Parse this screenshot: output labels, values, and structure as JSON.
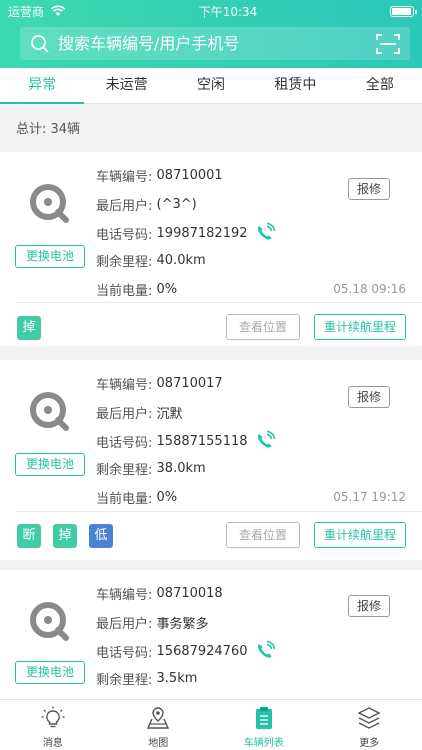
{
  "status_bar": {
    "carrier": "运营商",
    "time": "下午10:34"
  },
  "search": {
    "placeholder": "搜索车辆编号/用户手机号"
  },
  "tabs": [
    {
      "label": "异常",
      "active": true
    },
    {
      "label": "未运营",
      "active": false
    },
    {
      "label": "空闲",
      "active": false
    },
    {
      "label": "租赁中",
      "active": false
    },
    {
      "label": "全部",
      "active": false
    }
  ],
  "summary": {
    "total": "总计: 34辆"
  },
  "labels": {
    "vehicle_no": "车辆编号:",
    "last_user": "最后用户:",
    "phone": "电话号码:",
    "range": "剩余里程:",
    "battery": "当前电量:",
    "swap_battery": "更换电池",
    "repair": "报修",
    "view_location": "查看位置",
    "recalc_range": "重计续航里程"
  },
  "vehicles": [
    {
      "vehicle_no": "08710001",
      "last_user": "(^3^)",
      "phone": "19987182192",
      "range": "40.0km",
      "battery": "0%",
      "time": "05.18 09:16",
      "tags": [
        "掉"
      ]
    },
    {
      "vehicle_no": "08710017",
      "last_user": "沉默",
      "phone": "15887155118",
      "range": "38.0km",
      "battery": "0%",
      "time": "05.17 19:12",
      "tags": [
        "断",
        "掉",
        "低"
      ]
    },
    {
      "vehicle_no": "08710018",
      "last_user": "事务繁多",
      "phone": "15687924760",
      "range": "3.5km"
    }
  ],
  "bottom_nav": [
    {
      "label": "消息",
      "icon": "lightbulb-icon",
      "active": false
    },
    {
      "label": "地图",
      "icon": "map-icon",
      "active": false
    },
    {
      "label": "车辆列表",
      "icon": "clipboard-list-icon",
      "active": true
    },
    {
      "label": "更多",
      "icon": "layers-icon",
      "active": false
    }
  ],
  "colors": {
    "accent": "#22c3a6",
    "tag_green": "#3fcca6",
    "tag_blue": "#4a82d6"
  }
}
